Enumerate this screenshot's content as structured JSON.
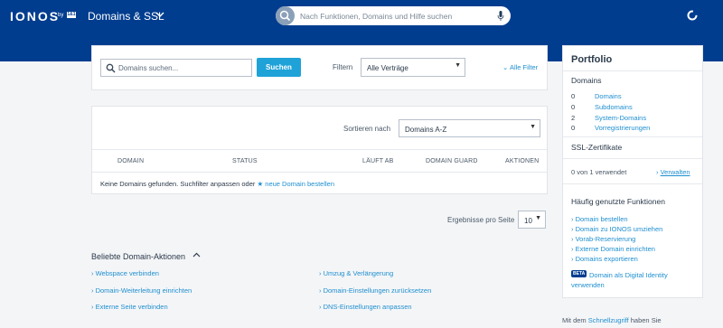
{
  "header": {
    "logo": "IONOS",
    "logo_by": "by",
    "logo_badge": "1&1",
    "app_title": "Domains & SSL",
    "search_placeholder": "Nach Funktionen, Domains und Hilfe suchen"
  },
  "filter": {
    "search_placeholder": "Domains suchen...",
    "search_button": "Suchen",
    "filter_label": "Filtern",
    "filter_value": "Alle Verträge",
    "all_filter": "Alle Filter"
  },
  "table": {
    "sort_label": "Sortieren nach",
    "sort_value": "Domains A-Z",
    "columns": [
      "DOMAIN",
      "STATUS",
      "LÄUFT AB",
      "DOMAIN GUARD",
      "AKTIONEN"
    ],
    "empty_message": "Keine Domains gefunden. Suchfilter anpassen oder",
    "empty_link": "neue Domain bestellen"
  },
  "pagination": {
    "results_label": "Ergebnisse pro Seite",
    "results_value": "10"
  },
  "domain_actions": {
    "title": "Beliebte Domain-Aktionen",
    "left": [
      "Webspace verbinden",
      "Domain-Weiterleitung einrichten",
      "Externe Seite verbinden"
    ],
    "right": [
      "Umzug & Verlängerung",
      "Domain-Einstellungen zurücksetzen",
      "DNS-Einstellungen anpassen"
    ]
  },
  "portfolio": {
    "title": "Portfolio",
    "domains_heading": "Domains",
    "items": [
      {
        "count": "0",
        "label": "Domains"
      },
      {
        "count": "0",
        "label": "Subdomains"
      },
      {
        "count": "2",
        "label": "System-Domains"
      },
      {
        "count": "0",
        "label": "Vorregistrierungen"
      }
    ],
    "ssl_heading": "SSL-Zertifikate",
    "ssl_usage": "0 von 1 verwendet",
    "ssl_manage": "Verwalten",
    "functions_heading": "Häufig genutzte Funktionen",
    "functions": [
      "Domain bestellen",
      "Domain zu IONOS umziehen",
      "Vorab-Reservierung",
      "Externe Domain einrichten",
      "Domains exportieren"
    ],
    "beta_badge": "BETA",
    "beta_link": "Domain als Digital Identity verwenden"
  },
  "footer": {
    "prefix": "Mit dem",
    "link": "Schnellzugriff",
    "suffix": "haben Sie"
  },
  "colors": {
    "brand": "#003d8f",
    "accent": "#1fa2d8",
    "link": "#1f8fd0"
  }
}
